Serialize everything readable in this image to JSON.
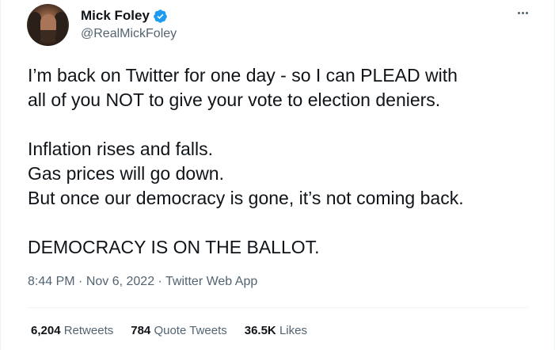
{
  "user": {
    "name": "Mick Foley",
    "handle": "@RealMickFoley"
  },
  "tweet": {
    "lines_para1": [
      "I’m back on Twitter for one day - so I can PLEAD with",
      "all of you NOT to give your vote to election deniers."
    ],
    "lines_para2": [
      "Inflation rises and falls.",
      "Gas prices will go down.",
      "But once our democracy is gone, it’s not coming back."
    ],
    "lines_para3": [
      "DEMOCRACY IS ON THE BALLOT."
    ]
  },
  "meta": {
    "time": "8:44 PM",
    "separator": " · ",
    "date": "Nov 6, 2022",
    "app": "Twitter Web App"
  },
  "stats": {
    "retweets_count": "6,204",
    "retweets_label": "Retweets",
    "quotes_count": "784",
    "quotes_label": "Quote Tweets",
    "likes_count": "36.5K",
    "likes_label": "Likes"
  },
  "colors": {
    "verified": "#1d9bf0",
    "secondary_text": "#536471",
    "primary_text": "#0f1419"
  }
}
